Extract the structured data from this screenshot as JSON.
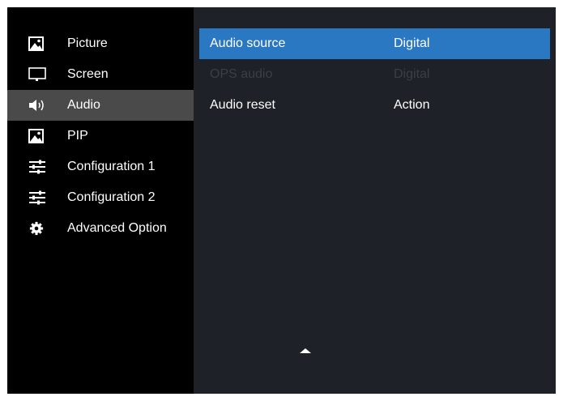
{
  "sidebar": {
    "items": [
      {
        "label": "Picture",
        "icon": "picture-icon",
        "selected": false
      },
      {
        "label": "Screen",
        "icon": "monitor-icon",
        "selected": false
      },
      {
        "label": "Audio",
        "icon": "speaker-icon",
        "selected": true
      },
      {
        "label": "PIP",
        "icon": "picture-icon",
        "selected": false
      },
      {
        "label": "Configuration 1",
        "icon": "sliders-icon",
        "selected": false
      },
      {
        "label": "Configuration 2",
        "icon": "sliders-icon",
        "selected": false
      },
      {
        "label": "Advanced Option",
        "icon": "gear-icon",
        "selected": false
      }
    ]
  },
  "main": {
    "rows": [
      {
        "name": "Audio source",
        "value": "Digital",
        "state": "selected"
      },
      {
        "name": "OPS audio",
        "value": "Digital",
        "state": "disabled"
      },
      {
        "name": "Audio reset",
        "value": "Action",
        "state": "normal"
      }
    ],
    "scroll_indicator": "triangle-up-icon"
  },
  "colors": {
    "sidebar_bg": "#000000",
    "sidebar_selected": "#4a4a4a",
    "main_bg": "#1e2127",
    "row_selected": "#2b78c2",
    "disabled_text": "#3b3f46"
  }
}
